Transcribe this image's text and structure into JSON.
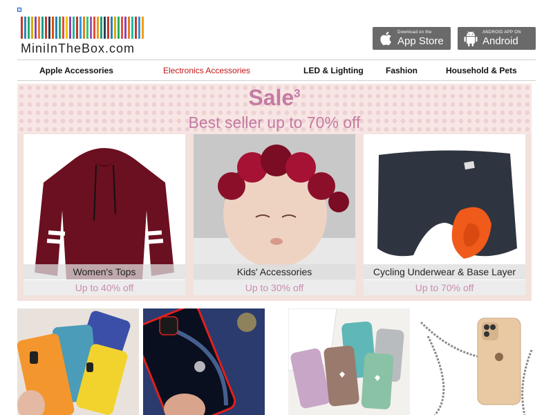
{
  "header": {
    "logo_text": "MiniInTheBox.com",
    "app_store": {
      "small": "Download on the",
      "big": "App Store"
    },
    "android": {
      "small": "ANDROID APP ON",
      "big": "Android"
    }
  },
  "nav": {
    "items": [
      {
        "label": "Apple Accessories"
      },
      {
        "label": "Electronics Accessories"
      },
      {
        "label": "LED & Lighting"
      },
      {
        "label": "Fashion"
      },
      {
        "label": "Household & Pets"
      }
    ],
    "active_color": "#c01515"
  },
  "banner": {
    "title": "Sale",
    "title_sup": "3",
    "subtitle": "Best seller up to 70% off",
    "cards": [
      {
        "label": "Women's Tops",
        "discount": "Up to 40% off"
      },
      {
        "label": "Kids' Accessories",
        "discount": "Up to 30% off"
      },
      {
        "label": "Cycling Underwear & Base Layer",
        "discount": "Up to 70% off"
      }
    ],
    "accent_color": "#c57aa3"
  },
  "products": [
    {
      "name": "colorful-phone-cases-image"
    },
    {
      "name": "chrome-iphone-case-image"
    },
    {
      "name": "heart-phone-cases-image"
    },
    {
      "name": "crossbody-clear-case-image"
    }
  ]
}
